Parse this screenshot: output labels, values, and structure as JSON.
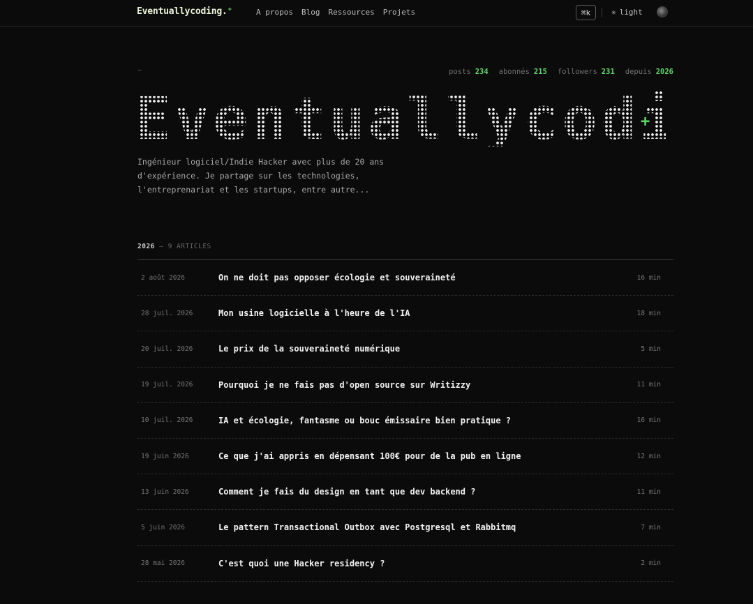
{
  "header": {
    "brand": "Eventuallycoding.",
    "brand_plus": "+",
    "nav": [
      "A propos",
      "Blog",
      "Ressources",
      "Projets"
    ],
    "shortcut": "⌘k",
    "theme_icon": "✳",
    "theme_label": "light"
  },
  "profile": {
    "tilde": "~",
    "stats": [
      {
        "label": "posts",
        "value": "234"
      },
      {
        "label": "abonnés",
        "value": "215"
      },
      {
        "label": "followers",
        "value": "231"
      },
      {
        "label": "depuis",
        "value": "2026"
      }
    ],
    "title": "Eventuallycoding",
    "title_plus": "+",
    "description": "Ingénieur logiciel/Indie Hacker avec plus de 20 ans d'expérience. Je partage sur les technologies, l'entreprenariat et les startups, entre autre..."
  },
  "section": {
    "year": "2026",
    "count": "— 9 ARTICLES"
  },
  "articles": [
    {
      "date": "2 août 2026",
      "title": "On ne doit pas opposer écologie et souveraineté",
      "read": "16 min"
    },
    {
      "date": "28 juil. 2026",
      "title": "Mon usine logicielle à l'heure de l'IA",
      "read": "18 min"
    },
    {
      "date": "20 juil. 2026",
      "title": "Le prix de la souveraineté numérique",
      "read": "5 min"
    },
    {
      "date": "19 juil. 2026",
      "title": "Pourquoi je ne fais pas d'open source sur Writizzy",
      "read": "11 min"
    },
    {
      "date": "10 juil. 2026",
      "title": "IA et écologie, fantasme ou bouc émissaire bien pratique ?",
      "read": "16 min"
    },
    {
      "date": "19 juin 2026",
      "title": "Ce que j'ai appris en dépensant 100€ pour de la pub en ligne",
      "read": "12 min"
    },
    {
      "date": "13 juin 2026",
      "title": "Comment je fais du design en tant que dev backend ?",
      "read": "11 min"
    },
    {
      "date": "5 juin 2026",
      "title": "Le pattern Transactional Outbox avec Postgresql et Rabbitmq",
      "read": "7 min"
    },
    {
      "date": "28 mai 2026",
      "title": "C'est quoi une Hacker residency ?",
      "read": "2 min"
    }
  ]
}
